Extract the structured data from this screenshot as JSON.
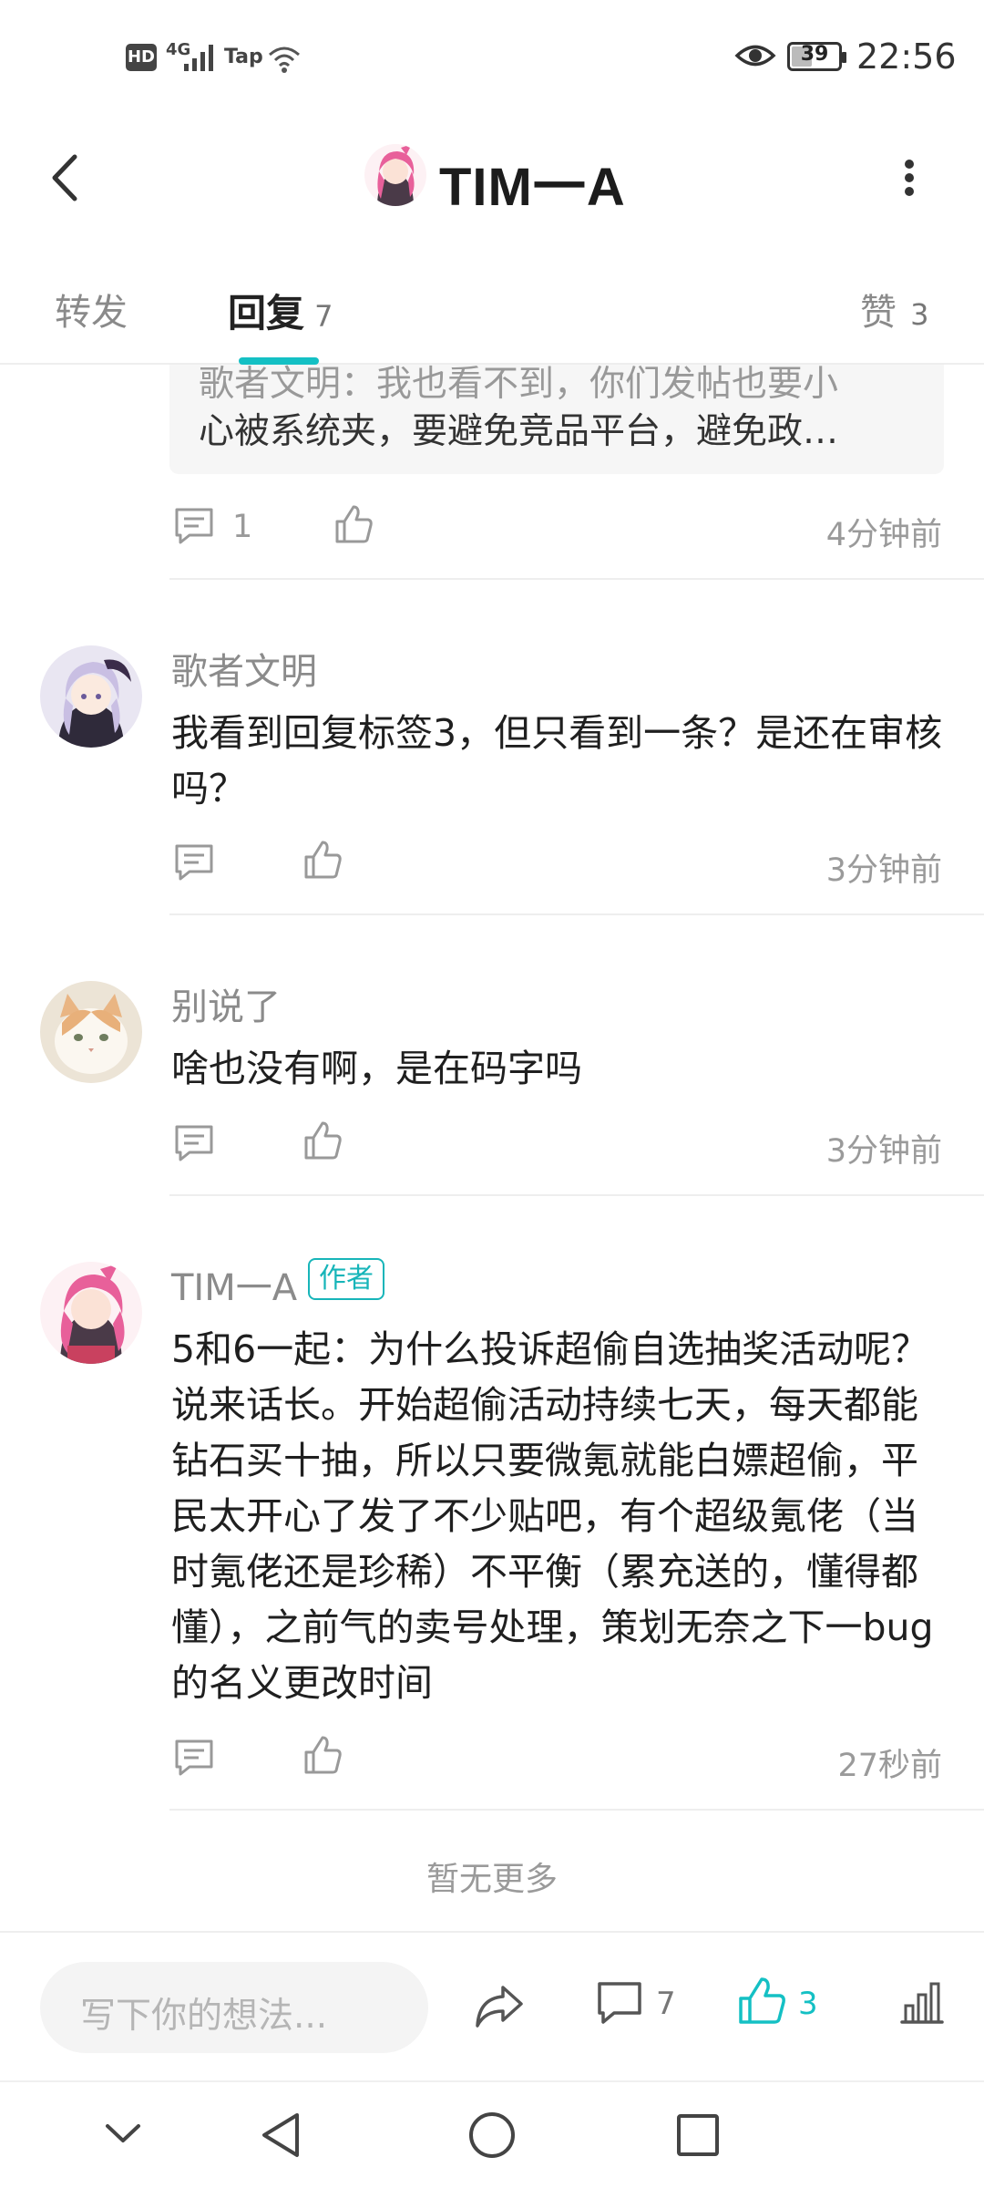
{
  "status_bar": {
    "hd": "HD",
    "network": "4G",
    "carrier": "Tap",
    "battery": "39",
    "time": "22:56"
  },
  "header": {
    "title": "TIM一A"
  },
  "tabs": {
    "forward": {
      "label": "转发"
    },
    "reply": {
      "label": "回复",
      "count": "7"
    },
    "like": {
      "label": "赞",
      "count": "3"
    }
  },
  "quoted": {
    "line1": "歌者文明：我也看不到，你们发帖也要小",
    "line2": "心被系统夹，要避免竞品平台，避免政…",
    "reply_count": "1",
    "time": "4分钟前"
  },
  "comments": [
    {
      "username": "歌者文明",
      "text": "我看到回复标签3，但只看到一条？是还在审核吗？",
      "time": "3分钟前"
    },
    {
      "username": "别说了",
      "text": "啥也没有啊，是在码字吗",
      "time": "3分钟前"
    },
    {
      "username": "TIM一A",
      "badge": "作者",
      "text": "5和6一起：为什么投诉超偷自选抽奖活动呢？说来话长。开始超偷活动持续七天，每天都能钻石买十抽，所以只要微氪就能白嫖超偷，平民太开心了发了不少贴吧，有个超级氪佬（当时氪佬还是珍稀）不平衡（累充送的，懂得都懂），之前气的卖号处理，策划无奈之下一bug的名义更改时间",
      "time": "27秒前"
    }
  ],
  "no_more": "暂无更多",
  "bottom_bar": {
    "placeholder": "写下你的想法...",
    "comment_count": "7",
    "like_count": "3"
  },
  "colors": {
    "accent": "#14c0c4",
    "author_pink": "#e8609a"
  }
}
